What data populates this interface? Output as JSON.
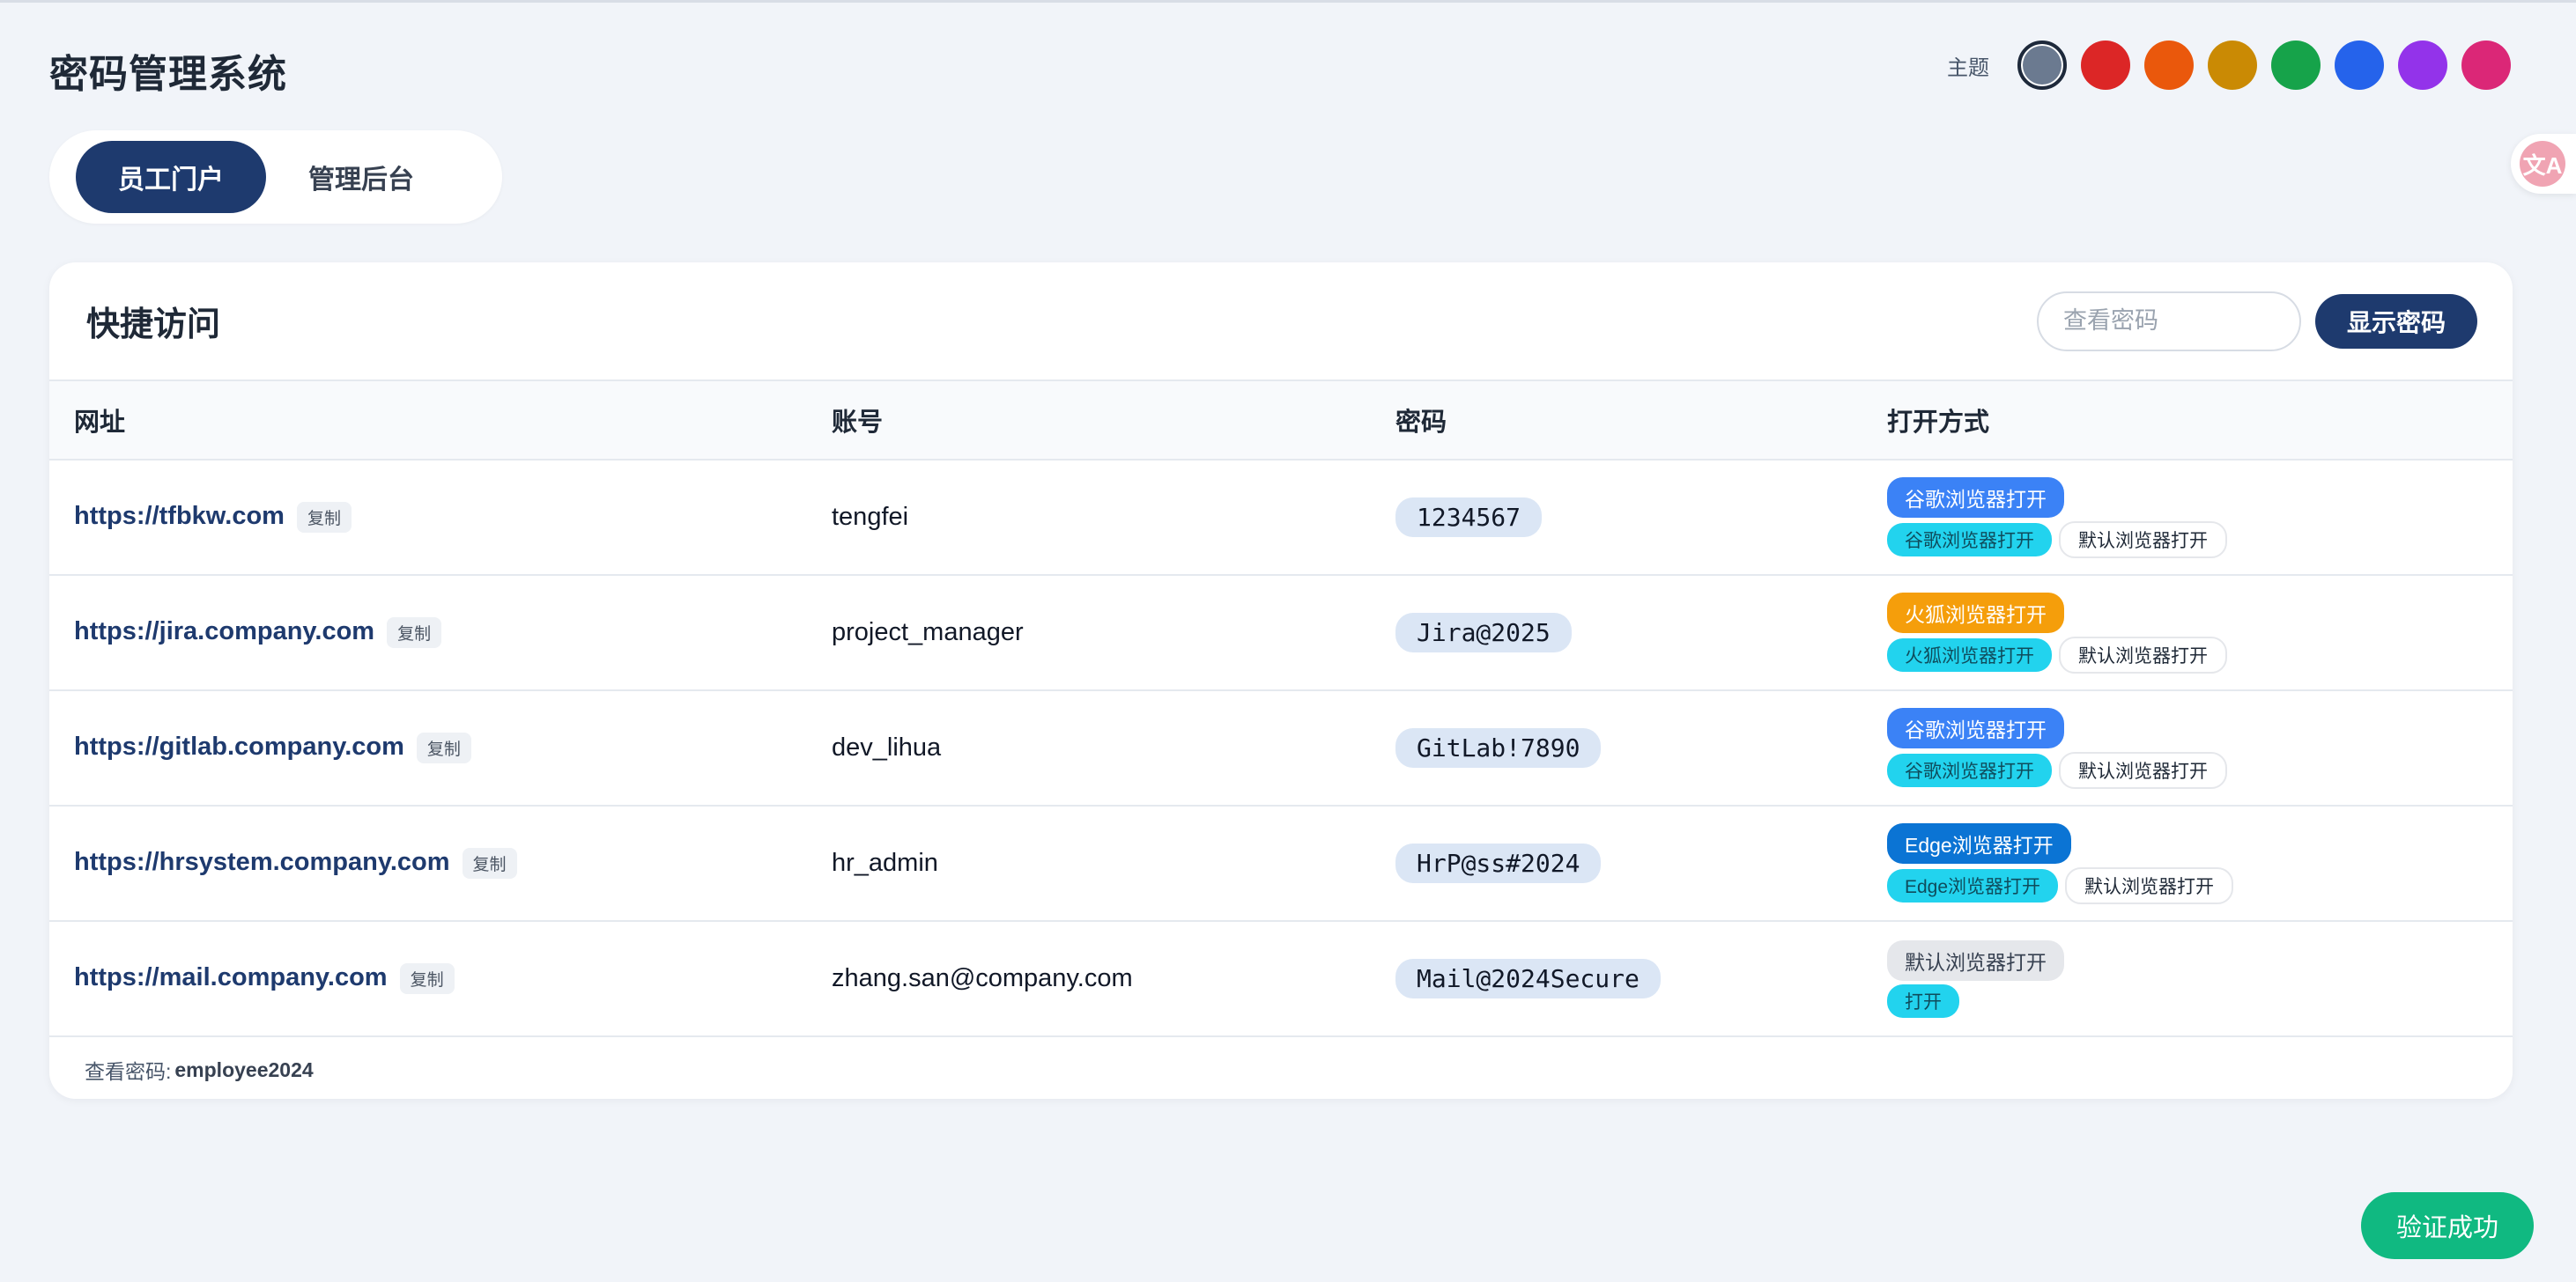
{
  "app": {
    "title": "密码管理系统"
  },
  "theme": {
    "label": "主题",
    "swatches": [
      "#6b7a90",
      "#dc2626",
      "#ea580c",
      "#ca8a04",
      "#16a34a",
      "#2563eb",
      "#9333ea",
      "#db2777"
    ],
    "active_index": 0
  },
  "tabs": [
    {
      "label": "员工门户",
      "active": true
    },
    {
      "label": "管理后台",
      "active": false
    }
  ],
  "quick_access": {
    "title": "快捷访问",
    "password_input": {
      "placeholder": "查看密码",
      "value": ""
    },
    "show_button": "显示密码",
    "columns": [
      "网址",
      "账号",
      "密码",
      "打开方式"
    ],
    "copy_label": "复制",
    "default_browser_label": "默认浏览器打开",
    "rows": [
      {
        "url": "https://tfbkw.com",
        "account": "tengfei",
        "password": "1234567",
        "open_main": "谷歌浏览器打开",
        "open_main_color": "#3b82f6",
        "open_sub": "谷歌浏览器打开",
        "show_default": true
      },
      {
        "url": "https://jira.company.com",
        "account": "project_manager",
        "password": "Jira@2025",
        "open_main": "火狐浏览器打开",
        "open_main_color": "#f59e0b",
        "open_sub": "火狐浏览器打开",
        "show_default": true
      },
      {
        "url": "https://gitlab.company.com",
        "account": "dev_lihua",
        "password": "GitLab!7890",
        "open_main": "谷歌浏览器打开",
        "open_main_color": "#3b82f6",
        "open_sub": "谷歌浏览器打开",
        "show_default": true
      },
      {
        "url": "https://hrsystem.company.com",
        "account": "hr_admin",
        "password": "HrP@ss#2024",
        "open_main": "Edge浏览器打开",
        "open_main_color": "#0b74d4",
        "open_sub": "Edge浏览器打开",
        "show_default": true
      },
      {
        "url": "https://mail.company.com",
        "account": "zhang.san@company.com",
        "password": "Mail@2024Secure",
        "open_main": "默认浏览器打开",
        "open_main_color": "#e5e7eb",
        "open_sub": "打开",
        "show_default": false
      }
    ],
    "footer_label": "查看密码:",
    "footer_value": "employee2024"
  },
  "toast": "验证成功",
  "colors": {
    "primary": "#1e3a6e",
    "success": "#10b981",
    "cyan": "#22d3ee"
  }
}
